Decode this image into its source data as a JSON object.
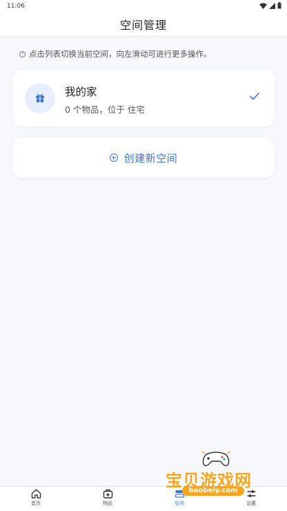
{
  "status_bar": {
    "time": "11:06"
  },
  "app_bar": {
    "title": "空间管理"
  },
  "hint": {
    "icon_glyph": "?",
    "text": "点击列表切换当前空间，向左滑动可进行更多操作。"
  },
  "spaces": [
    {
      "name": "我的家",
      "meta": "0 个物品，位于 住宅",
      "selected": true,
      "icon": "gift-icon"
    }
  ],
  "create_button": {
    "label": "创建新空间"
  },
  "bottom_nav": {
    "items": [
      {
        "label": "首页",
        "icon": "home-icon",
        "active": false
      },
      {
        "label": "物品",
        "icon": "box-plus-icon",
        "active": false
      },
      {
        "label": "空间",
        "icon": "space-icon",
        "active": true
      },
      {
        "label": "设置",
        "icon": "sliders-icon",
        "active": false
      }
    ]
  },
  "watermark": {
    "text": "宝贝游戏网",
    "url": "baobeiy.com"
  },
  "colors": {
    "accent": "#3a73d9",
    "background": "#f6f8fc",
    "card": "#ffffff",
    "watermark": "#f5a524"
  }
}
